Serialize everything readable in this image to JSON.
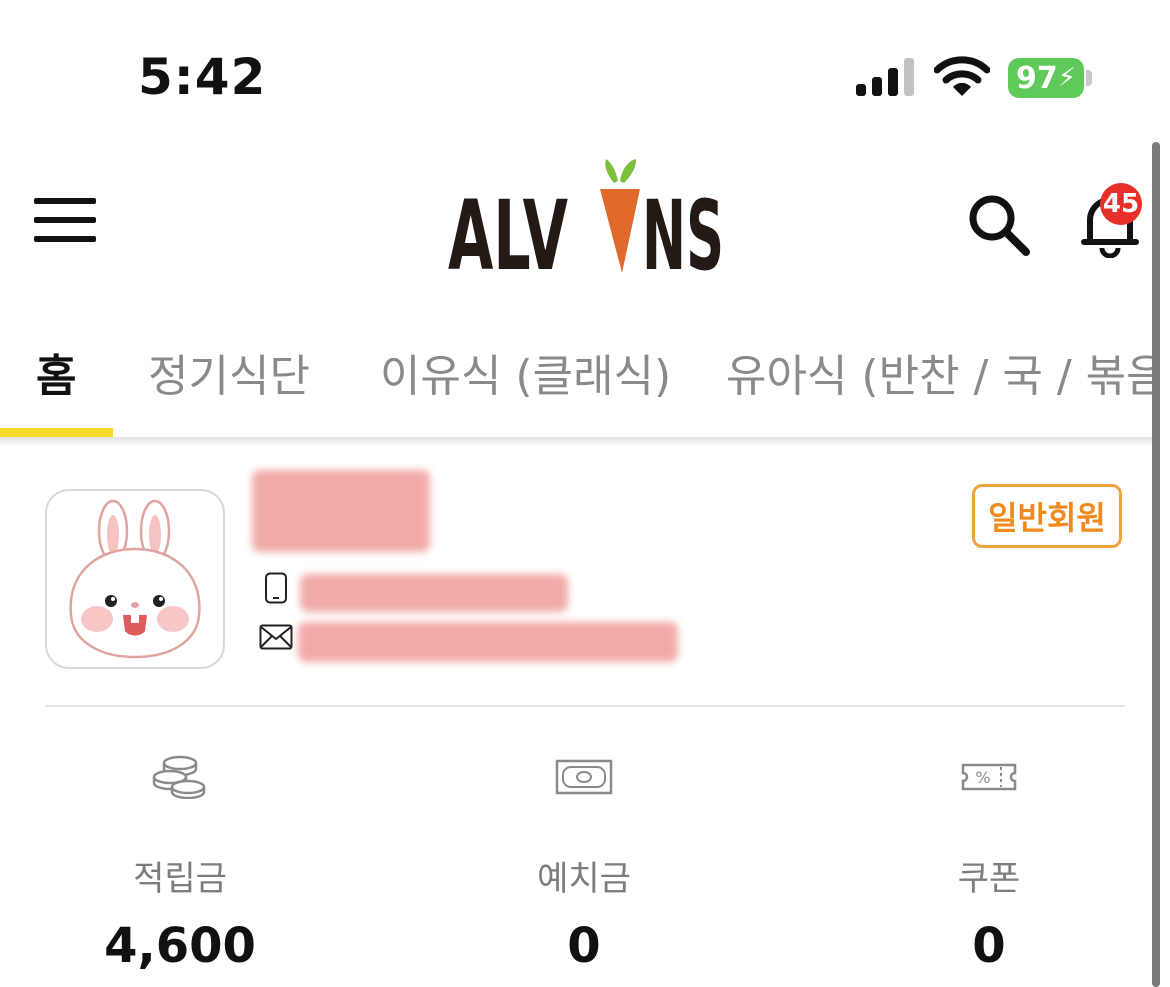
{
  "status_bar": {
    "time": "5:42",
    "battery": "97"
  },
  "header": {
    "logo_text": "ALVINS",
    "notification_count": "45"
  },
  "tabs": [
    {
      "label": "홈",
      "active": true
    },
    {
      "label": "정기식단",
      "active": false
    },
    {
      "label": "이유식 (클래식)",
      "active": false
    },
    {
      "label": "유아식 (반찬 / 국 / 볶음밥",
      "active": false
    }
  ],
  "profile": {
    "grade": "일반회원"
  },
  "stats": [
    {
      "label": "적립금",
      "value": "4,600",
      "icon": "coins-icon"
    },
    {
      "label": "예치금",
      "value": "0",
      "icon": "cash-icon"
    },
    {
      "label": "쿠폰",
      "value": "0",
      "icon": "coupon-icon"
    }
  ],
  "colors": {
    "accent_yellow": "#f5db2b",
    "badge_orange": "#f08a1c",
    "badge_red": "#e8302a",
    "battery_green": "#5fc95a"
  }
}
